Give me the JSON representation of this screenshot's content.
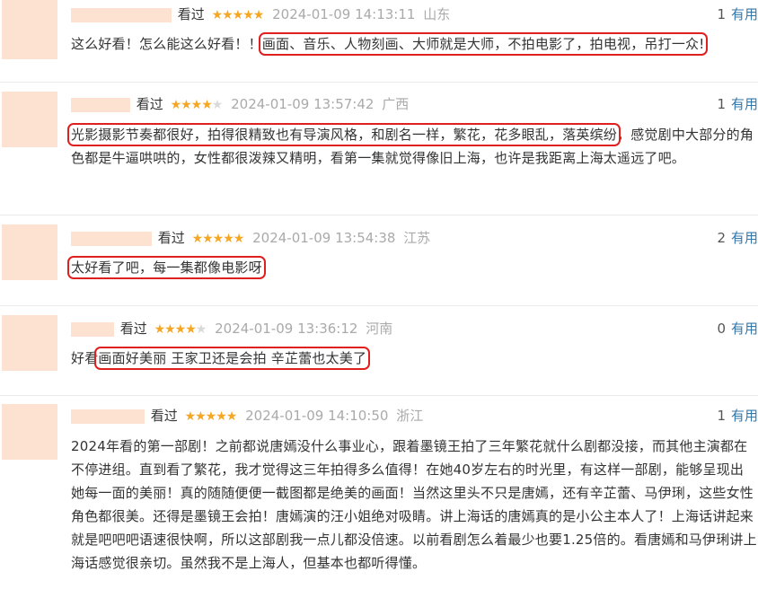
{
  "reviews": [
    {
      "status": "看过",
      "rating": 5,
      "time": "2024-01-09 14:13:11",
      "location": "山东",
      "votes": "1",
      "useful_label": "有用",
      "content_before": "这么好看！怎么能这么好看！！",
      "content_highlight": "画面、音乐、人物刻画、大师就是大师，不拍电影了，拍电视，吊打一众!",
      "content_after": ""
    },
    {
      "status": "看过",
      "rating": 4,
      "time": "2024-01-09 13:57:42",
      "location": "广西",
      "votes": "1",
      "useful_label": "有用",
      "content_before": "",
      "content_highlight": "光影摄影节奏都很好，拍得很精致也有导演风格，和剧名一样，繁花，花多眼乱，落英缤纷",
      "content_after": "，感觉剧中大部分的角色都是牛逼哄哄的，女性都很泼辣又精明，看第一集就觉得像旧上海，也许是我距离上海太遥远了吧。"
    },
    {
      "status": "看过",
      "rating": 5,
      "time": "2024-01-09 13:54:38",
      "location": "江苏",
      "votes": "2",
      "useful_label": "有用",
      "content_before": "",
      "content_highlight": "太好看了吧，每一集都像电影呀",
      "content_after": ""
    },
    {
      "status": "看过",
      "rating": 4,
      "time": "2024-01-09 13:36:12",
      "location": "河南",
      "votes": "0",
      "useful_label": "有用",
      "content_before": "好看",
      "content_highlight": "画面好美丽 王家卫还是会拍 辛芷蕾也太美了",
      "content_after": ""
    },
    {
      "status": "看过",
      "rating": 5,
      "time": "2024-01-09 14:10:50",
      "location": "浙江",
      "votes": "1",
      "useful_label": "有用",
      "content_before": "2024年看的第一部剧！之前都说唐嫣没什么事业心，跟着墨镜王拍了三年繁花就什么剧都没接，而其他主演都在不停进组。直到看了繁花，我才觉得这三年拍得多么值得！在她40岁左右的时光里，有这样一部剧，能够呈现出她每一面的美丽！真的随随便便一截图都是绝美的画面！当然这里头不只是唐嫣，还有辛芷蕾、马伊琍，这些女性角色都很美。还得是墨镜王会拍！唐嫣演的汪小姐绝对吸睛。讲上海话的唐嫣真的是小公主本人了！上海话讲起来就是吧吧吧语速很快啊，所以这部剧我一点儿都没倍速。以前看剧怎么着最少也要1.25倍的。看唐嫣和马伊琍讲上海话感觉很亲切。虽然我不是上海人，但基本也都听得懂。",
      "content_highlight": "",
      "content_after": ""
    }
  ],
  "colors": {
    "star": "#f5a623",
    "star_off": "#d9d9d9",
    "highlight_box": "#e01f1f",
    "link": "#3377aa",
    "avatar_mask": "#fde1d1"
  }
}
